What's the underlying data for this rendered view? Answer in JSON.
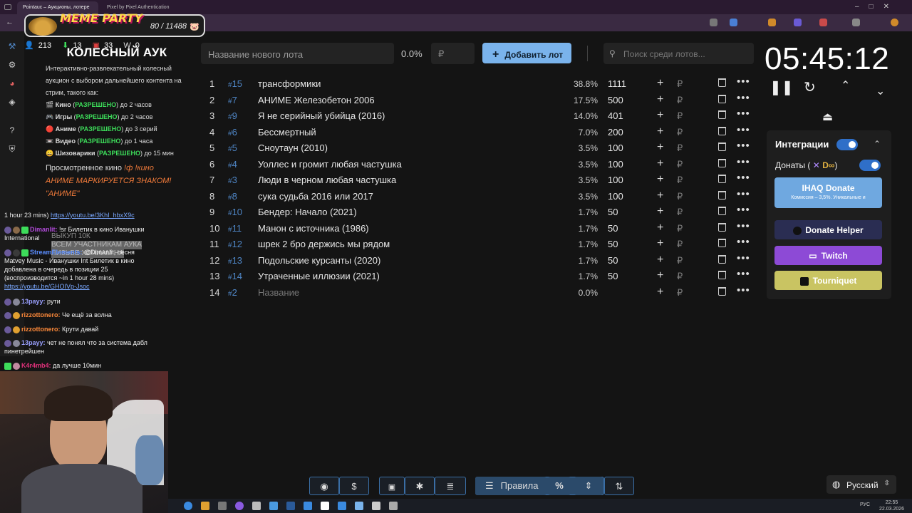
{
  "browser": {
    "tabs": [
      {
        "label": "Pointauc – Аукционы, лотере"
      },
      {
        "label": "Pixel by Pixel Authentication"
      }
    ]
  },
  "overlay": {
    "title": "MEME PARTY",
    "counter": "80 / 11488",
    "stats": {
      "viewers": "213",
      "a": "13",
      "b": "33",
      "c": "0"
    }
  },
  "rules": {
    "title": "КОЛЕСНЫЙ АУК",
    "description": "Интерактивно-развлекательный колесный аукцион с выбором дальнейшего контента на стрим, такого как:",
    "items": [
      {
        "icon": "🎬",
        "label": "Кино",
        "status": "РАЗРЕШЕНО",
        "rest": "до 2 часов"
      },
      {
        "icon": "🎮",
        "label": "Игры",
        "status": "РАЗРЕШЕНО",
        "rest": "до 2 часов"
      },
      {
        "icon": "🔴",
        "label": "Аниме",
        "status": "РАЗРЕШЕНО",
        "rest": "до 3 серий"
      },
      {
        "icon": "📼",
        "label": "Видео",
        "status": "РАЗРЕШЕНО",
        "rest": "до 1 часа"
      },
      {
        "icon": "😀",
        "label": "Шизоварики",
        "status": "РАЗРЕШЕНО",
        "rest": "до 15 мин"
      }
    ],
    "watched_label": "Просмотренное кино",
    "watched_cmd": "!ф !кино",
    "anime_note": "АНИМЕ МАРКИРУЕТСЯ ЗНАКОМ!",
    "anime_mark": "\"АНИМЕ\""
  },
  "chat": {
    "messages": [
      {
        "user": "",
        "text": "1 hour 23 mins)",
        "link": "https://youtu.be/3KhI_hbxX9c"
      },
      {
        "user": "Dimanlit:",
        "text": "!sr Билетик в кино Иванушки International"
      },
      {
        "user": "StreamElements:",
        "text": "@Dimanlit, песня Matvey Music - Иванушки Int Билетик в кино добавлена в очередь в позиции 25 (воспроизводится ~in 1 hour 28 mins)",
        "link": "https://youtu.be/GHOIVp-Jsoc"
      },
      {
        "user": "13payy:",
        "text": "рути"
      },
      {
        "user": "rizzottonero:",
        "text": "Че ещё за волна"
      },
      {
        "user": "rizzottonero:",
        "text": "Крути давай"
      },
      {
        "user": "13payy:",
        "text": "чет не понял что за система дабл пинетрейшен"
      },
      {
        "user": "K4r4mb4:",
        "text": "да лучше 10мин"
      }
    ],
    "ghost": [
      "ВЫКУП 10К",
      "ВСЕМ УЧАСТНИКАМ АУКА",
      "ЛИЗЬБЕ ХОЧИАМ НА"
    ]
  },
  "toolbar": {
    "lot_name_placeholder": "Название нового лота",
    "lot_percent": "0.0%",
    "lot_cost_placeholder": "₽",
    "add_label": "Добавить лот",
    "search_placeholder": "Поиск среди лотов..."
  },
  "lots": [
    {
      "n": "1",
      "id": "15",
      "name": "трансформики",
      "pct": "38.8%",
      "amount": "1111"
    },
    {
      "n": "2",
      "id": "7",
      "name": "АНИМЕ Железобетон 2006",
      "pct": "17.5%",
      "amount": "500"
    },
    {
      "n": "3",
      "id": "9",
      "name": "Я не серийный убийца (2016)",
      "pct": "14.0%",
      "amount": "401"
    },
    {
      "n": "4",
      "id": "6",
      "name": "Бессмертный",
      "pct": "7.0%",
      "amount": "200"
    },
    {
      "n": "5",
      "id": "5",
      "name": "Сноутаун (2010)",
      "pct": "3.5%",
      "amount": "100"
    },
    {
      "n": "6",
      "id": "4",
      "name": "Уоллес и громит любая частушка",
      "pct": "3.5%",
      "amount": "100"
    },
    {
      "n": "7",
      "id": "3",
      "name": "Люди в черном любая частушка",
      "pct": "3.5%",
      "amount": "100"
    },
    {
      "n": "8",
      "id": "8",
      "name": "сука судьба 2016 или 2017",
      "pct": "3.5%",
      "amount": "100"
    },
    {
      "n": "9",
      "id": "10",
      "name": "Бендер: Начало (2021)",
      "pct": "1.7%",
      "amount": "50"
    },
    {
      "n": "10",
      "id": "11",
      "name": "Манон с источника (1986)",
      "pct": "1.7%",
      "amount": "50"
    },
    {
      "n": "11",
      "id": "12",
      "name": "шрек 2 бро держись мы рядом",
      "pct": "1.7%",
      "amount": "50"
    },
    {
      "n": "12",
      "id": "13",
      "name": "Подольские курсанты (2020)",
      "pct": "1.7%",
      "amount": "50"
    },
    {
      "n": "13",
      "id": "14",
      "name": "Утраченные иллюзии (2021)",
      "pct": "1.7%",
      "amount": "50"
    },
    {
      "n": "14",
      "id": "2",
      "name": "Название",
      "pct": "0.0%",
      "amount": "",
      "placeholder": true
    }
  ],
  "lot_symbols": {
    "hash": "#",
    "rub": "₽",
    "plus": "+",
    "more": "•••"
  },
  "timer": {
    "value": "05:45:12"
  },
  "integrations": {
    "title": "Интеграции",
    "donations_label": "Донаты (",
    "donations_close": ")",
    "ihaq_title": "IHAQ Donate",
    "ihaq_sub": "Комиссия – 3,5%. Уникальные и",
    "donate_helper": "Donate Helper",
    "twitch": "Twitch",
    "tourniquet": "Tourniquet"
  },
  "bottom": {
    "rules_label": "Правила",
    "percent": "%",
    "language": "Русский"
  },
  "clock": {
    "time": "22:55",
    "date": "22.03.2026",
    "lang": "РУС"
  },
  "colors": {
    "accent": "#7ab3ec",
    "id": "#4f86c6",
    "allowed": "#3ddc5a",
    "twitch": "#8d4ad6",
    "tourniquet": "#c9c462"
  }
}
